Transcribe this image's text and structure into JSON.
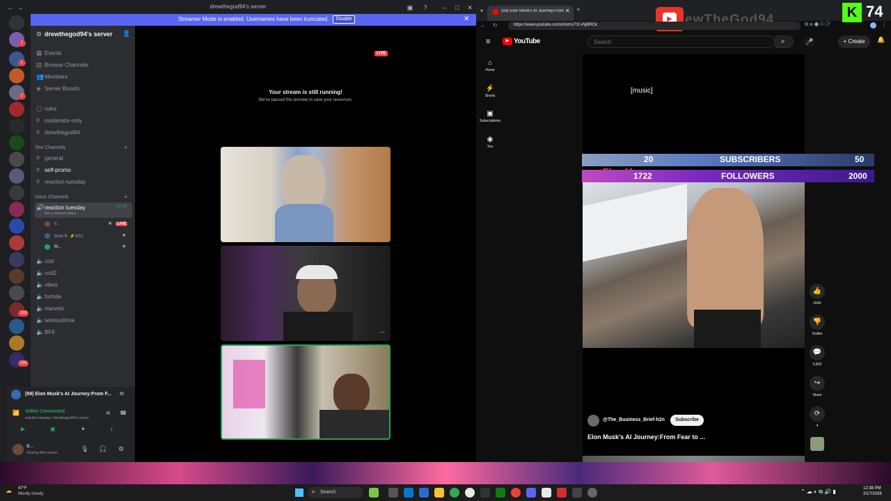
{
  "discord": {
    "window_title": "drewthegod94's server",
    "streamer_mode_text": "Streamer Mode is enabled. Usernames have been truncated.",
    "disable_label": "Disable",
    "server_name": "drewthegod94's server",
    "server_badges": [
      "1",
      "1",
      "2",
      "1",
      "1",
      "7",
      "3",
      "1",
      "1",
      "1",
      "2",
      "3",
      "2",
      "1",
      "1",
      "103",
      "2",
      "231"
    ],
    "top_items": [
      "Events",
      "Browse Channels",
      "Members",
      "Server Boosts"
    ],
    "channels": [
      "rules",
      "moderator-only",
      "drewthegod94"
    ],
    "category_text": "Text Channels",
    "text_channels": [
      "general",
      "self-promo",
      "reaction-tuesday"
    ],
    "category_voice": "Voice Channels",
    "voice_channel": "reaction tuesday",
    "voice_timer": "18:13",
    "voice_status": "Set a channel status",
    "voice_users": [
      "d...",
      "Brad R. ⚡NSC",
      "M..."
    ],
    "live_label": "LIVE",
    "more_channels": [
      "cod",
      "cod2",
      "vibes",
      "fortnite",
      "marvels",
      "workouttime",
      "BF6"
    ],
    "now_playing": "(59) Elon Musk's AI Journey:From F...",
    "voice_connected": "Video Connected",
    "voice_connected_sub": "reaction tuesday / drewthegod94's server",
    "user_name": "d...",
    "user_status": "Sharing their screen",
    "stream_running_title": "Your stream is still running!",
    "stream_running_sub": "We've paused this preview to save your resources.",
    "stage_live": "LIVE"
  },
  "browser": {
    "tab_title": "(59) Elon Musk's AI Journey:From",
    "url": "https://www.youtube.com/shorts/71f-rNjBRCk",
    "overlay_name": "ewTheGod94",
    "overlay_count": "74"
  },
  "youtube": {
    "logo": "YouTube",
    "search_placeholder": "Search",
    "create_label": "Create",
    "nav": [
      "Home",
      "Shorts",
      "Subscriptions",
      "You"
    ],
    "caption": "[music]",
    "subs_left": "20",
    "subs_label": "SUBSCRIBERS",
    "subs_right": "50",
    "follow_left": "1722",
    "follow_label": "FOLLOWERS",
    "follow_right": "2000",
    "ghost_name": "Elon M",
    "ghost_text": "Sat, conquering chatGPT",
    "likes": "166K",
    "dislike_label": "Dislike",
    "comments": "5,829",
    "share_label": "Share",
    "remix_count": "4",
    "channel": "@The_Business_Brief-h2n",
    "subscribe_label": "Subscribe",
    "short_title": "Elon Musk's AI Journey:From Fear to ..."
  },
  "taskbar": {
    "weather_temp": "47°F",
    "weather_desc": "Mostly cloudy",
    "search_label": "Search",
    "time": "12:38 PM",
    "date": "2/17/2026"
  },
  "colors": {
    "discord_blurple": "#5865f2",
    "live_red": "#f23f43",
    "yt_red": "#ff0000"
  }
}
